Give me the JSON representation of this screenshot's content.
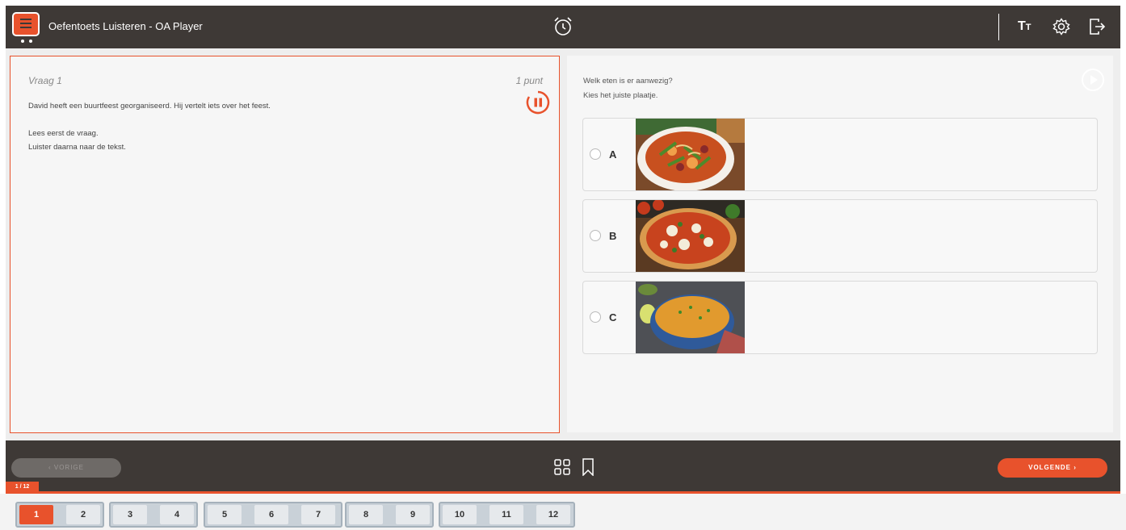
{
  "header": {
    "title": "Oefentoets Luisteren - OA Player",
    "icons": [
      "app-logo-icon",
      "alarm-clock-icon",
      "text-size-icon",
      "gear-icon",
      "exit-icon"
    ],
    "text_size_label_big": "T",
    "text_size_label_small": "T"
  },
  "question": {
    "label": "Vraag 1",
    "points": "1 punt",
    "intro": "David heeft een buurtfeest georganiseerd. Hij vertelt iets over het feest.",
    "instruction_1": "Lees eerst de vraag.",
    "instruction_2": "Luister daarna naar de tekst."
  },
  "answer": {
    "prompt": "Welk eten is er aanwezig?",
    "hint": "Kies het juiste plaatje.",
    "options": [
      {
        "letter": "A",
        "image": "soup-photo"
      },
      {
        "letter": "B",
        "image": "pizza-photo"
      },
      {
        "letter": "C",
        "image": "rice-photo"
      }
    ]
  },
  "footer": {
    "prev_label": "‹  VORIGE",
    "next_label": "VOLGENDE  ›",
    "progress": "1 / 12"
  },
  "nav": {
    "items": [
      "1",
      "2",
      "3",
      "4",
      "5",
      "6",
      "7",
      "8",
      "9",
      "10",
      "11",
      "12"
    ],
    "active": "1"
  },
  "colors": {
    "accent": "#e8522c",
    "bar": "#3e3936",
    "panel": "#f6f6f6"
  }
}
